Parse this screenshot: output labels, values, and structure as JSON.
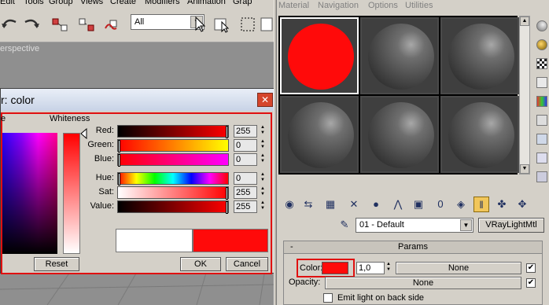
{
  "main_menu": {
    "items": [
      "Edit",
      "Tools",
      "Group",
      "Views",
      "Create",
      "Modifiers",
      "Animation",
      "Grap"
    ]
  },
  "toolbar": {
    "selection_filter": "All"
  },
  "viewport": {
    "label": "erspective"
  },
  "color_dialog": {
    "title": "r: color",
    "hue_header": "e",
    "whiteness_header": "Whiteness",
    "sliders": [
      {
        "name": "Red:",
        "value": "255"
      },
      {
        "name": "Green:",
        "value": "0"
      },
      {
        "name": "Blue:",
        "value": "0"
      },
      {
        "name": "Hue:",
        "value": "0"
      },
      {
        "name": "Sat:",
        "value": "255"
      },
      {
        "name": "Value:",
        "value": "255"
      }
    ],
    "reset_label": "Reset",
    "ok_label": "OK",
    "cancel_label": "Cancel",
    "old_color": "#ffffff",
    "new_color": "#ff0a0a",
    "highlight_color": "#e01010"
  },
  "material_editor": {
    "menu": [
      "Material",
      "Navigation",
      "Options",
      "Utilities"
    ],
    "active_slot_color": "#ff0a0a",
    "material_name": "01 - Default",
    "material_type": "VRayLightMtl",
    "rollout_title": "Params",
    "rollout_toggle": "-",
    "color_label": "Color:",
    "color_multiplier": "1,0",
    "color_map_label": "None",
    "opacity_label": "Opacity:",
    "opacity_map_label": "None",
    "emit_back_label": "Emit light on back side"
  }
}
